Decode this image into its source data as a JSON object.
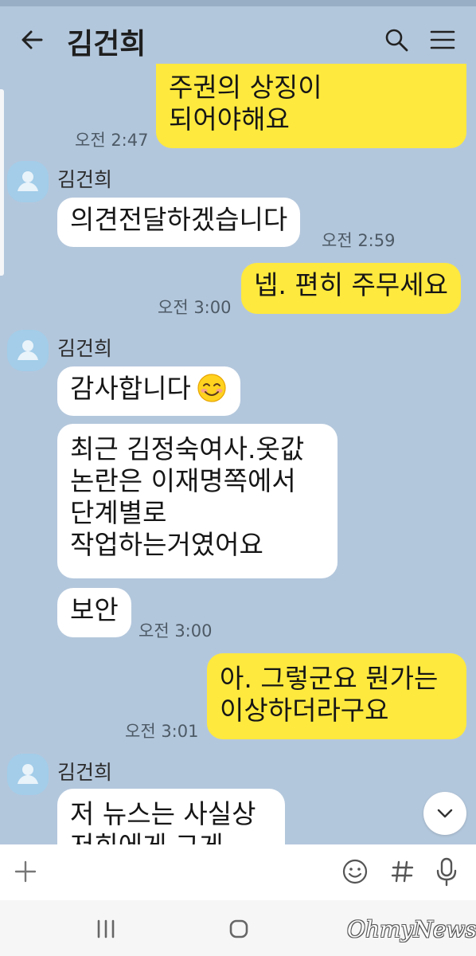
{
  "header": {
    "title": "김건희",
    "back_icon": "arrow-left-icon",
    "search_icon": "search-icon",
    "menu_icon": "hamburger-menu-icon"
  },
  "messages": [
    {
      "from": "me",
      "lines": [
        "주권의 상징이",
        "되어야해요"
      ],
      "time": "오전 2:47"
    },
    {
      "from": "them",
      "sender": "김건희",
      "lines": [
        "의견전달하겠습니다"
      ],
      "time": "오전 2:59"
    },
    {
      "from": "me",
      "lines": [
        "넵. 편히 주무세요"
      ],
      "time": "오전 3:00"
    },
    {
      "from": "them",
      "sender": "김건희",
      "lines": [
        "감사합니다"
      ],
      "emoji": "smiling-face-emoji"
    },
    {
      "from": "them",
      "lines": [
        "최근 김정숙여사.옷값",
        "논란은 이재명쪽에서",
        "단계별로",
        "작업하는거였어요"
      ]
    },
    {
      "from": "them",
      "lines": [
        "보안"
      ],
      "time": "오전 3:00"
    },
    {
      "from": "me",
      "lines": [
        "아. 그렇군요 뭔가는",
        "이상하더라구요"
      ],
      "time": "오전 3:01"
    },
    {
      "from": "them",
      "sender": "김건희",
      "lines": [
        "저 뉴스는 사실상",
        "저희에게 그게"
      ]
    }
  ],
  "input_bar": {
    "plus_icon": "plus-icon",
    "emoji_icon": "emoji-icon",
    "hash_icon": "hash-icon",
    "mic_icon": "microphone-icon"
  },
  "scroll_button_icon": "chevron-down-icon",
  "nav": {
    "recent_icon": "recent-apps-icon",
    "home_icon": "home-icon",
    "back_icon": "back-icon"
  },
  "watermark": "OhmyNews",
  "colors": {
    "chat_background": "#b3c7dc",
    "my_bubble": "#fee93e",
    "their_bubble": "#ffffff",
    "avatar": "#a3cde9"
  }
}
